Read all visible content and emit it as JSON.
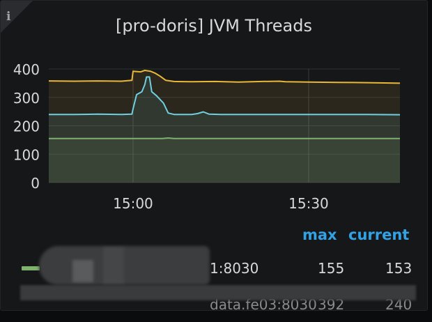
{
  "panel": {
    "title": "[pro-doris] JVM Threads",
    "info_icon": "i"
  },
  "chart_data": {
    "type": "line",
    "title": "[pro-doris] JVM Threads",
    "xlabel": "",
    "ylabel": "",
    "ylim": [
      0,
      400
    ],
    "yticks": [
      "0",
      "100",
      "200",
      "300",
      "400"
    ],
    "xticks": [
      {
        "minute": 0,
        "label": "15:00"
      },
      {
        "minute": 30,
        "label": "15:30"
      }
    ],
    "xlim_minutes_from_1500": [
      -14.4,
      45.6
    ],
    "grid": true,
    "series": [
      {
        "color": "#eab839",
        "points": [
          [
            -14.4,
            358
          ],
          [
            -10,
            357
          ],
          [
            -6,
            358
          ],
          [
            -2,
            357
          ],
          [
            -0.2,
            360
          ],
          [
            0,
            392
          ],
          [
            1.3,
            390
          ],
          [
            2,
            395
          ],
          [
            3,
            392
          ],
          [
            3.8,
            385
          ],
          [
            4.6,
            375
          ],
          [
            5.6,
            360
          ],
          [
            7,
            356
          ],
          [
            10,
            355
          ],
          [
            14,
            356
          ],
          [
            18,
            354
          ],
          [
            22,
            356
          ],
          [
            25,
            357
          ],
          [
            26,
            355
          ],
          [
            30,
            354
          ],
          [
            35,
            353
          ],
          [
            40,
            352
          ],
          [
            43,
            351
          ],
          [
            45.6,
            350
          ]
        ]
      },
      {
        "color": "#6ed0e0",
        "points": [
          [
            -14.4,
            240
          ],
          [
            -10,
            240
          ],
          [
            -6,
            241
          ],
          [
            -2,
            240
          ],
          [
            -0.2,
            241
          ],
          [
            0,
            260
          ],
          [
            0.6,
            310
          ],
          [
            1.5,
            320
          ],
          [
            2,
            345
          ],
          [
            2.3,
            372
          ],
          [
            2.8,
            372
          ],
          [
            3.2,
            320
          ],
          [
            4,
            306
          ],
          [
            5.2,
            280
          ],
          [
            6,
            245
          ],
          [
            7,
            240
          ],
          [
            10,
            240
          ],
          [
            11,
            243
          ],
          [
            12,
            249
          ],
          [
            13,
            241
          ],
          [
            15,
            240
          ],
          [
            20,
            240
          ],
          [
            25,
            240
          ],
          [
            30,
            240
          ],
          [
            36,
            240
          ],
          [
            40,
            240
          ],
          [
            45.6,
            239
          ]
        ]
      },
      {
        "color": "#7eb26d",
        "points": [
          [
            -14.4,
            155
          ],
          [
            -5,
            155
          ],
          [
            0,
            155
          ],
          [
            5,
            155
          ],
          [
            6,
            157
          ],
          [
            7,
            155
          ],
          [
            15,
            155
          ],
          [
            30,
            155
          ],
          [
            45.6,
            155
          ]
        ]
      }
    ]
  },
  "legend": {
    "headers": {
      "max": "max",
      "current": "current"
    },
    "rows": [
      {
        "name": "1:8030",
        "max": "155",
        "current": "153",
        "color": "#7eb26d"
      },
      {
        "name": "data.fe03:8030",
        "max": "392",
        "current": "240",
        "color": "#eab839"
      }
    ]
  }
}
